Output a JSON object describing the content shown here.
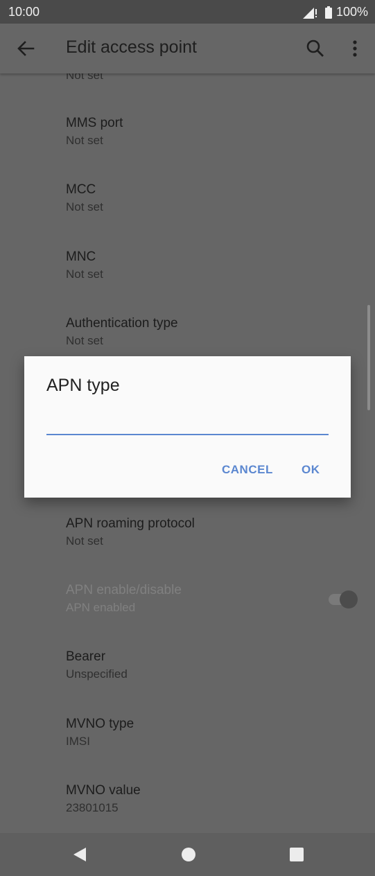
{
  "status": {
    "time": "10:00",
    "battery": "100%"
  },
  "app_bar": {
    "title": "Edit access point"
  },
  "list": {
    "cut_top_subtitle": "Not set",
    "items": [
      {
        "title": "MMS port",
        "subtitle": "Not set"
      },
      {
        "title": "MCC",
        "subtitle": "Not set"
      },
      {
        "title": "MNC",
        "subtitle": "Not set"
      },
      {
        "title": "Authentication type",
        "subtitle": "Not set"
      },
      {
        "title": "APN roaming protocol",
        "subtitle": "Not set"
      },
      {
        "title": "APN enable/disable",
        "subtitle": "APN enabled"
      },
      {
        "title": "Bearer",
        "subtitle": "Unspecified"
      },
      {
        "title": "MVNO type",
        "subtitle": "IMSI"
      },
      {
        "title": "MVNO value",
        "subtitle": "23801015"
      }
    ]
  },
  "dialog": {
    "title": "APN type",
    "input_value": "",
    "cancel_label": "CANCEL",
    "ok_label": "OK"
  },
  "colors": {
    "accent": "#5b87d0",
    "scrim_background": "#666666",
    "dialog_background": "#fafafa"
  },
  "icons": {
    "back": "arrow-left-icon",
    "search": "search-icon",
    "more": "more-vert-icon"
  }
}
